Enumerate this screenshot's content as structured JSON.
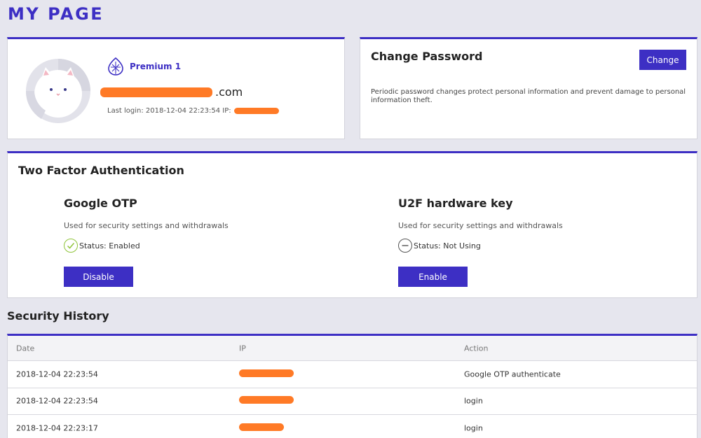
{
  "page": {
    "title": "MY PAGE"
  },
  "profile": {
    "tier": "Premium 1",
    "email_suffix": ".com",
    "last_login_label": "Last login: 2018-12-04 22:23:54 IP:",
    "accent": "#3d2fc4",
    "redaction_color": "#ff7a26"
  },
  "password": {
    "title": "Change Password",
    "button": "Change",
    "description": "Periodic password changes protect personal information and prevent damage to personal information theft."
  },
  "tfa": {
    "title": "Two Factor Authentication",
    "methods": [
      {
        "name": "Google OTP",
        "desc": "Used for security settings and withdrawals",
        "status": "Status: Enabled",
        "status_icon": "check-circle-icon",
        "button": "Disable"
      },
      {
        "name": "U2F hardware key",
        "desc": "Used for security settings and withdrawals",
        "status": "Status: Not Using",
        "status_icon": "minus-circle-icon",
        "button": "Enable"
      }
    ]
  },
  "security_history": {
    "title": "Security History",
    "columns": [
      "Date",
      "IP",
      "Action"
    ],
    "rows": [
      {
        "date": "2018-12-04 22:23:54",
        "action": "Google OTP authenticate"
      },
      {
        "date": "2018-12-04 22:23:54",
        "action": "login"
      },
      {
        "date": "2018-12-04 22:23:17",
        "action": "login"
      }
    ]
  }
}
